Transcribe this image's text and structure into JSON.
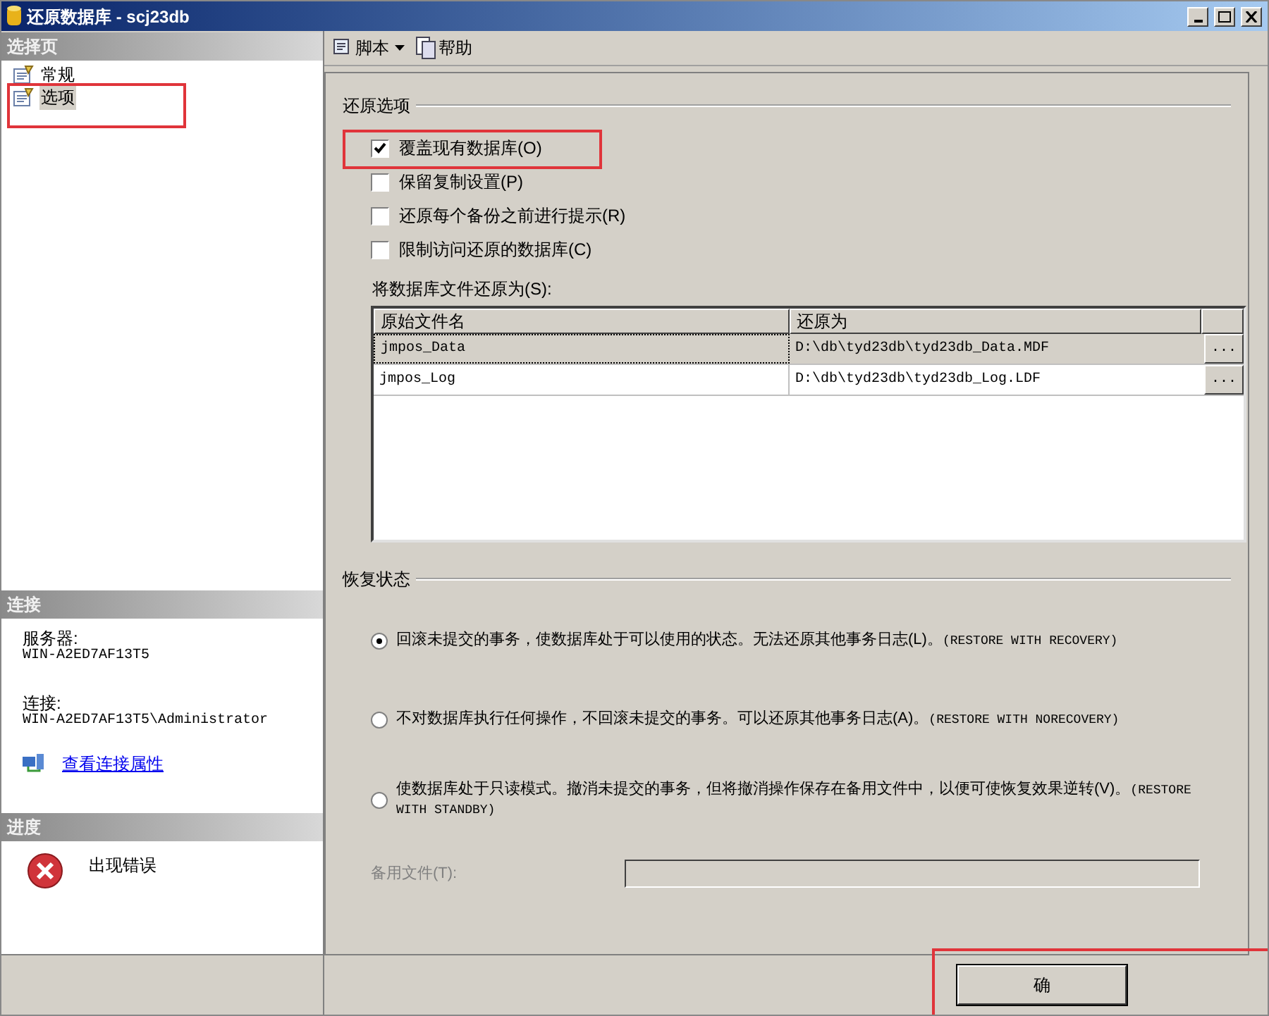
{
  "window": {
    "title": "还原数据库 - scj23db"
  },
  "sidebar": {
    "pages_header": "选择页",
    "pages": [
      {
        "label": "常规",
        "selected": false
      },
      {
        "label": "选项",
        "selected": true
      }
    ],
    "connection_header": "连接",
    "server_label": "服务器:",
    "server": "WIN-A2ED7AF13T5",
    "connection_label": "连接:",
    "connection": "WIN-A2ED7AF13T5\\Administrator",
    "view_link": "查看连接属性",
    "progress_header": "进度",
    "progress_status": "出现错误"
  },
  "toolbar": {
    "script": "脚本",
    "help": "帮助"
  },
  "restore_options": {
    "title": "还原选项",
    "options": [
      {
        "label": "覆盖现有数据库(O)",
        "checked": true
      },
      {
        "label": "保留复制设置(P)",
        "checked": false
      },
      {
        "label": "还原每个备份之前进行提示(R)",
        "checked": false
      },
      {
        "label": "限制访问还原的数据库(C)",
        "checked": false
      }
    ]
  },
  "files": {
    "label": "将数据库文件还原为(S):",
    "columns": [
      "原始文件名",
      "还原为"
    ],
    "rows": [
      {
        "original": "jmpos_Data",
        "restore_as": "D:\\db\\tyd23db\\tyd23db_Data.MDF",
        "browse": "...",
        "selected": true
      },
      {
        "original": "jmpos_Log",
        "restore_as": "D:\\db\\tyd23db\\tyd23db_Log.LDF",
        "browse": "...",
        "selected": false
      }
    ]
  },
  "recovery": {
    "title": "恢复状态",
    "options": [
      {
        "label": "回滚未提交的事务，使数据库处于可以使用的状态。无法还原其他事务日志(L)。",
        "mode": "(RESTORE WITH RECOVERY)",
        "selected": true
      },
      {
        "label": "不对数据库执行任何操作，不回滚未提交的事务。可以还原其他事务日志(A)。",
        "mode": "(RESTORE WITH NORECOVERY)",
        "selected": false
      },
      {
        "label": "使数据库处于只读模式。撤消未提交的事务，但将撤消操作保存在备用文件中，以便可使恢复效果逆转(V)。",
        "mode": "(RESTORE WITH STANDBY)",
        "selected": false
      }
    ],
    "standby_file": {
      "label": "备用文件(T):",
      "disabled": true
    }
  },
  "buttons": [
    "确"
  ]
}
